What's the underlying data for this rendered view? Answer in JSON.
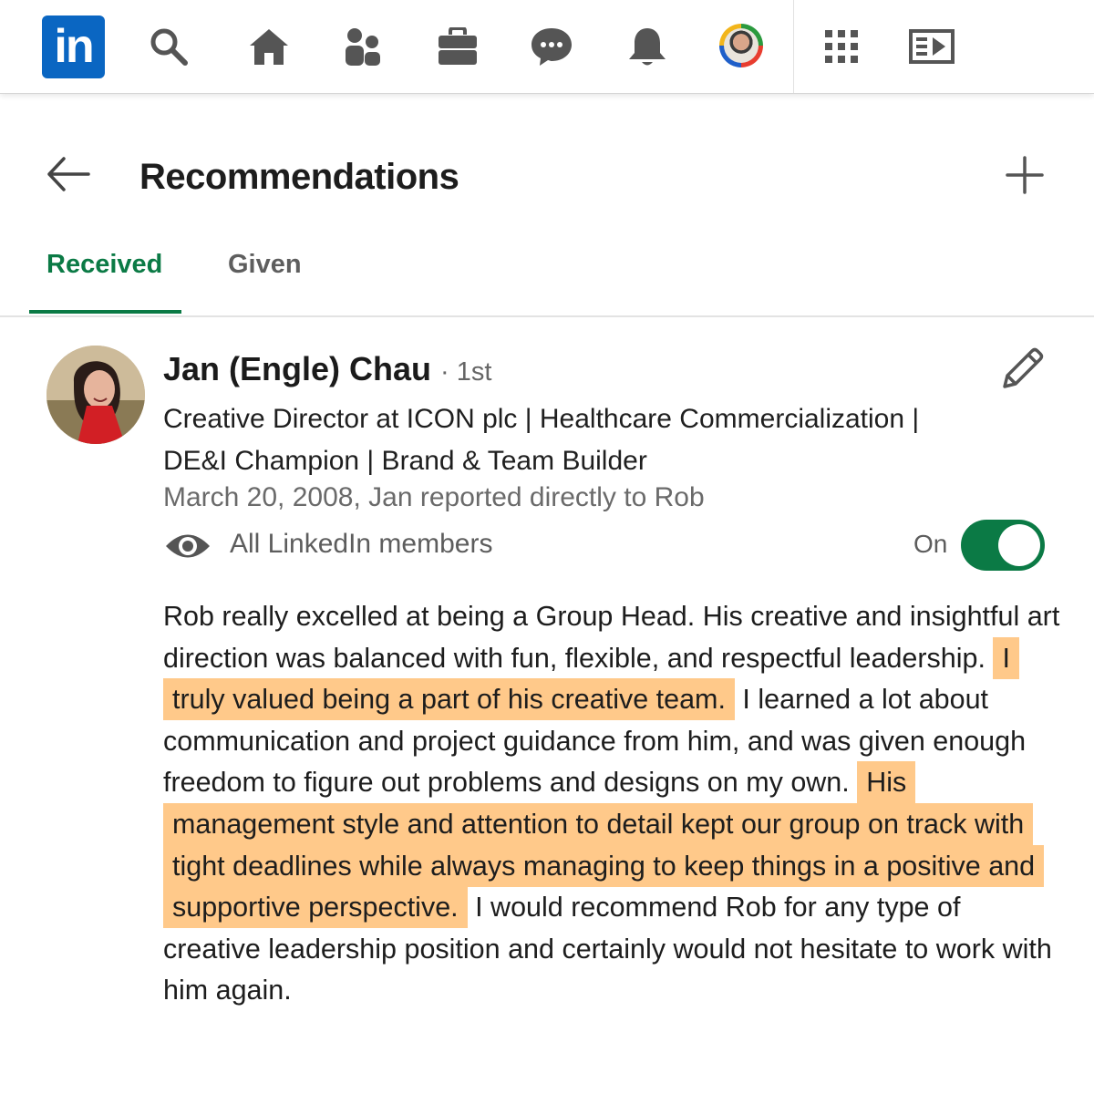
{
  "nav": {
    "logo_text": "in",
    "brand_color": "#0a66c2",
    "icons": [
      "search-icon",
      "home-icon",
      "my-network-icon",
      "jobs-icon",
      "messaging-icon",
      "notifications-icon",
      "profile-avatar",
      "apps-grid-icon",
      "learning-icon"
    ]
  },
  "header": {
    "title": "Recommendations"
  },
  "tabs": [
    {
      "label": "Received",
      "active": true
    },
    {
      "label": "Given",
      "active": false
    }
  ],
  "accent_color": "#0b7a45",
  "highlight_color": "#ffc98a",
  "recommendation": {
    "name": "Jan (Engle) Chau",
    "degree": "· 1st",
    "headline": "Creative Director at ICON plc | Healthcare Commercialization | DE&I Champion | Brand & Team Builder",
    "relationship": "March 20, 2008, Jan reported directly to Rob",
    "visibility": "All LinkedIn members",
    "toggle_label": "On",
    "toggle_on": true,
    "body": {
      "p1": "Rob really excelled at being a Group Head. His creative and insightful art direction was balanced with fun, flexible, and respectful leadership. ",
      "h1": "I truly valued being a part of his creative team.",
      "p2": " I learned a lot about communication and project guidance from him, and was given enough freedom to figure out problems and designs on my own. ",
      "h2": "His management style and attention to detail kept our group on track with tight deadlines while always managing to keep things in a positive and supportive perspective.",
      "p3": " I would recommend Rob for any type of creative leadership position and certainly would not hesitate to work with him again."
    }
  }
}
